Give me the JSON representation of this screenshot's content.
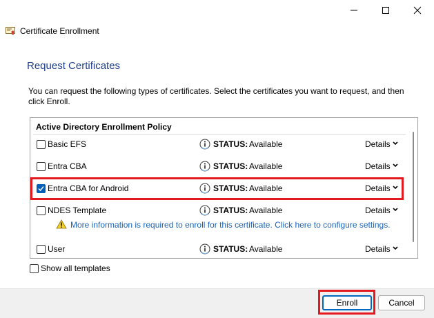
{
  "window": {
    "controls": [
      "minimize-icon",
      "maximize-icon",
      "close-icon"
    ]
  },
  "wizard": {
    "title": "Certificate Enrollment"
  },
  "page": {
    "heading": "Request Certificates",
    "description": "You can request the following types of certificates. Select the certificates you want to request, and then click Enroll."
  },
  "policy": {
    "name": "Active Directory Enrollment Policy",
    "items": [
      {
        "name": "Basic EFS",
        "checked": false,
        "status_label": "STATUS:",
        "status": "Available",
        "details": "Details"
      },
      {
        "name": "Entra CBA",
        "checked": false,
        "status_label": "STATUS:",
        "status": "Available",
        "details": "Details"
      },
      {
        "name": "Entra CBA for Android",
        "checked": true,
        "status_label": "STATUS:",
        "status": "Available",
        "details": "Details"
      },
      {
        "name": "NDES Template",
        "checked": false,
        "status_label": "STATUS:",
        "status": "Available",
        "details": "Details",
        "warning": "More information is required to enroll for this certificate. Click here to configure settings."
      },
      {
        "name": "User",
        "checked": false,
        "status_label": "STATUS:",
        "status": "Available",
        "details": "Details"
      }
    ]
  },
  "show_all": {
    "label": "Show all templates",
    "checked": false
  },
  "buttons": {
    "enroll": "Enroll",
    "cancel": "Cancel"
  },
  "colors": {
    "heading": "#1e3e8c",
    "link": "#1a63b8",
    "highlight": "#e3191f",
    "accent": "#005fb8"
  }
}
